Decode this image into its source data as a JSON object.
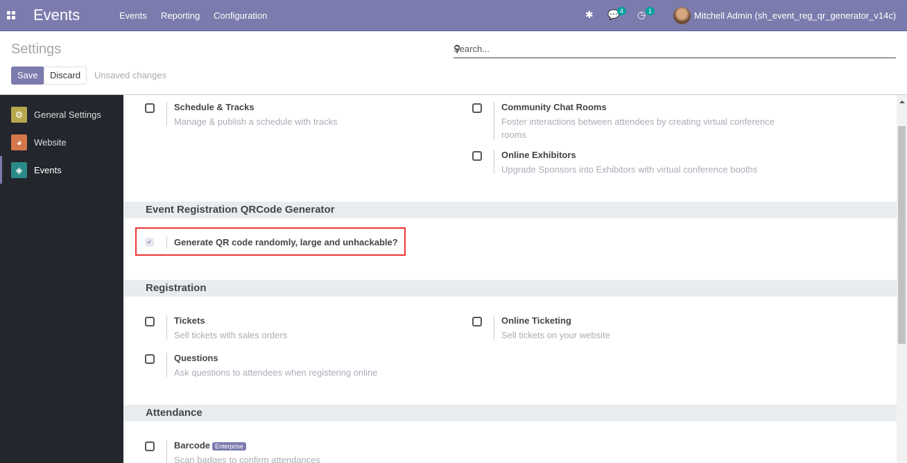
{
  "navbar": {
    "app": "Events",
    "menu": [
      "Events",
      "Reporting",
      "Configuration"
    ],
    "messages_count": "4",
    "activities_count": "1",
    "user": "Mitchell Admin (sh_event_reg_qr_generator_v14c)"
  },
  "control": {
    "title": "Settings",
    "search_placeholder": "Search...",
    "save": "Save",
    "discard": "Discard",
    "unsaved": "Unsaved changes"
  },
  "sidebar": [
    {
      "label": "General Settings",
      "color": "#b5a84f"
    },
    {
      "label": "Website",
      "color": "#d3774a"
    },
    {
      "label": "Events",
      "color": "#2a8a87"
    }
  ],
  "settings": {
    "schedule": {
      "name": "Schedule & Tracks",
      "desc": "Manage & publish a schedule with tracks"
    },
    "chat": {
      "name": "Community Chat Rooms",
      "desc": "Foster interactions between attendees by creating virtual conference rooms"
    },
    "exhibitors": {
      "name": "Online Exhibitors",
      "desc": "Upgrade Sponsors into Exhibitors with virtual conference booths"
    },
    "qr_section": "Event Registration QRCode Generator",
    "qr": {
      "name": "Generate QR code randomly, large and unhackable?",
      "checked": true
    },
    "reg_section": "Registration",
    "tickets": {
      "name": "Tickets",
      "desc": "Sell tickets with sales orders"
    },
    "online_ticketing": {
      "name": "Online Ticketing",
      "desc": "Sell tickets on your website"
    },
    "questions": {
      "name": "Questions",
      "desc": "Ask questions to attendees when registering online"
    },
    "att_section": "Attendance",
    "barcode": {
      "name": "Barcode",
      "badge": "Enterprise",
      "desc": "Scan badges to confirm attendances"
    }
  }
}
